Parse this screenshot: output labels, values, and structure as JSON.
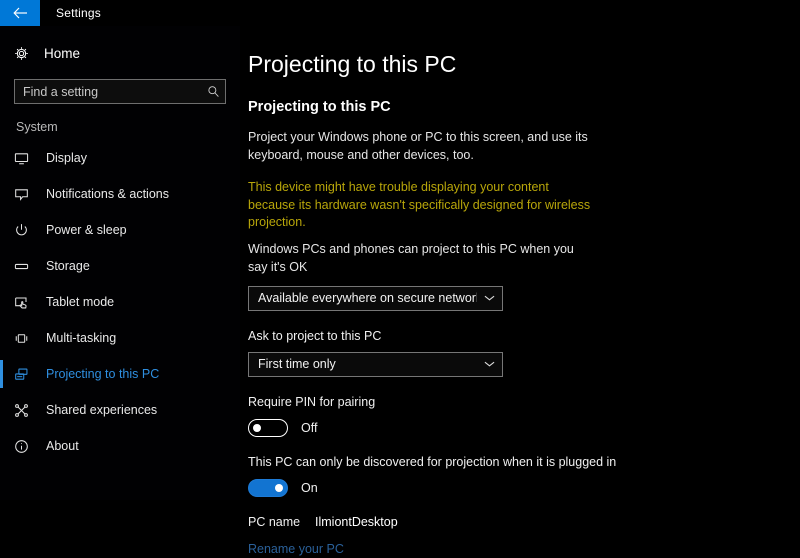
{
  "titlebar": {
    "back_icon": "back-arrow-icon",
    "title": "Settings",
    "accent_color": "#0078d7"
  },
  "sidebar": {
    "home": {
      "icon": "gear-icon",
      "label": "Home"
    },
    "search": {
      "placeholder": "Find a setting",
      "value": "",
      "icon": "search-icon"
    },
    "group_title": "System",
    "items": [
      {
        "label": "Display",
        "icon": "monitor-icon",
        "selected": false
      },
      {
        "label": "Notifications & actions",
        "icon": "speech-bubble-icon",
        "selected": false
      },
      {
        "label": "Power & sleep",
        "icon": "power-icon",
        "selected": false
      },
      {
        "label": "Storage",
        "icon": "drive-icon",
        "selected": false
      },
      {
        "label": "Tablet mode",
        "icon": "tablet-hand-icon",
        "selected": false
      },
      {
        "label": "Multi-tasking",
        "icon": "multitask-icon",
        "selected": false
      },
      {
        "label": "Projecting to this PC",
        "icon": "projector-icon",
        "selected": true
      },
      {
        "label": "Shared experiences",
        "icon": "share-nodes-icon",
        "selected": false
      },
      {
        "label": "About",
        "icon": "info-icon",
        "selected": false
      }
    ],
    "selected_color": "#2f8fe0"
  },
  "main": {
    "page_title": "Projecting to this PC",
    "section_title": "Projecting to this PC",
    "description": "Project your Windows phone or PC to this screen, and use its keyboard, mouse and other devices, too.",
    "warning": "This device might have trouble displaying your content because its hardware wasn't specifically designed for wireless projection.",
    "warning_color": "#b8a60a",
    "availability_label": "Windows PCs and phones can project to this PC when you say it's OK",
    "availability_value": "Available everywhere on secure networks",
    "ask_label": "Ask to project to this PC",
    "ask_value": "First time only",
    "pin_label": "Require PIN for pairing",
    "pin_state": "Off",
    "pin_on": false,
    "plugged_label": "This PC can only be discovered for projection when it is plugged in",
    "plugged_state": "On",
    "plugged_on": true,
    "pc_name_label": "PC name",
    "pc_name_value": "IlmiontDesktop",
    "rename_link": "Rename your PC",
    "link_color": "#2a6099",
    "chevron_icon": "chevron-down-icon"
  }
}
